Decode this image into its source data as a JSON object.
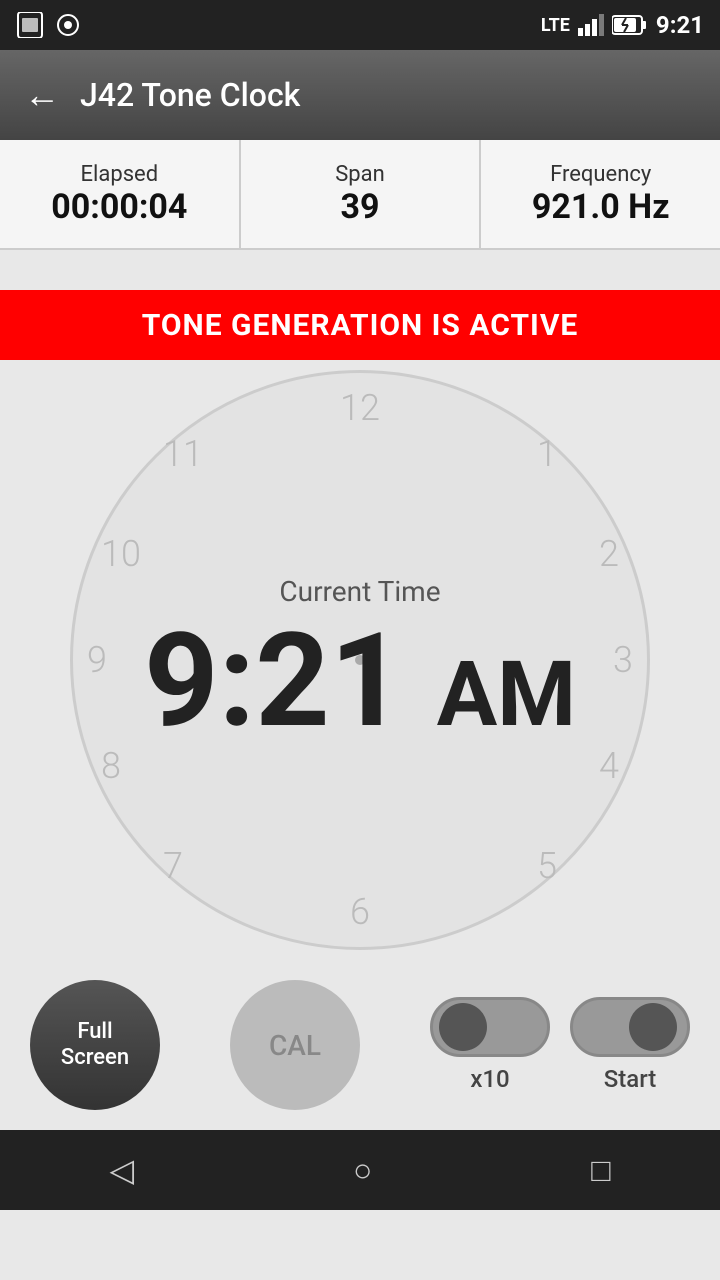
{
  "statusBar": {
    "time": "9:21",
    "lte": "LTE",
    "batteryLevel": 80
  },
  "appBar": {
    "title": "J42 Tone Clock",
    "backLabel": "←"
  },
  "stats": {
    "elapsedLabel": "Elapsed",
    "elapsedValue": "00:00:04",
    "spanLabel": "Span",
    "spanValue": "39",
    "frequencyLabel": "Frequency",
    "frequencyValue": "921.0 Hz"
  },
  "banner": {
    "text": "TONE GENERATION IS ACTIVE"
  },
  "clock": {
    "currentTimeLabel": "Current Time",
    "time": "9:21",
    "ampm": "AM",
    "numbers": [
      "12",
      "1",
      "2",
      "3",
      "4",
      "5",
      "6",
      "7",
      "8",
      "9",
      "10",
      "11"
    ]
  },
  "controls": {
    "fullScreenLabel": "Full\nScreen",
    "calLabel": "CAL",
    "x10Label": "x10",
    "startLabel": "Start",
    "x10State": "off",
    "startState": "on"
  },
  "navBar": {
    "backIcon": "◁",
    "homeIcon": "○",
    "recentsIcon": "□"
  }
}
